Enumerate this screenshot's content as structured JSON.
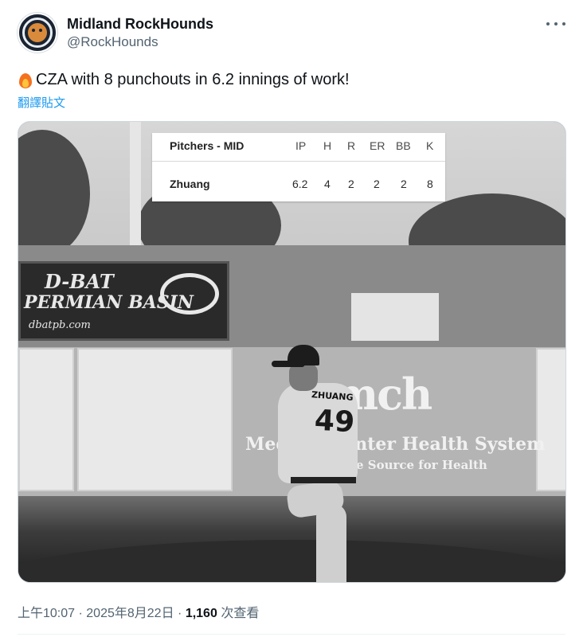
{
  "author": {
    "display_name": "Midland RockHounds",
    "handle": "@RockHounds",
    "avatar_icon": "rockhounds-logo-icon"
  },
  "tweet": {
    "emoji_icon": "fire-icon",
    "text": "CZA with 8 punchouts in 6.2 innings of work!",
    "translate_label": "翻譯貼文"
  },
  "image": {
    "box_score": {
      "header": [
        "Pitchers - MID",
        "IP",
        "H",
        "R",
        "ER",
        "BB",
        "K"
      ],
      "rows": [
        [
          "Zhuang",
          "6.2",
          "4",
          "2",
          "2",
          "2",
          "8"
        ]
      ]
    },
    "jersey_name": "ZHUANG",
    "jersey_number": "49",
    "signs": {
      "dbat_line1": "D-BAT",
      "dbat_line2": "PERMIAN BASIN",
      "dbat_line3": "dbatpb.com",
      "mch_logo": "mch",
      "mch_line": "Medical Center Health System",
      "mch_sub": "One Source for Health"
    }
  },
  "meta": {
    "time": "上午10:07",
    "separator": "·",
    "date": "2025年8月22日",
    "views": "1,160",
    "views_label": "次查看"
  }
}
